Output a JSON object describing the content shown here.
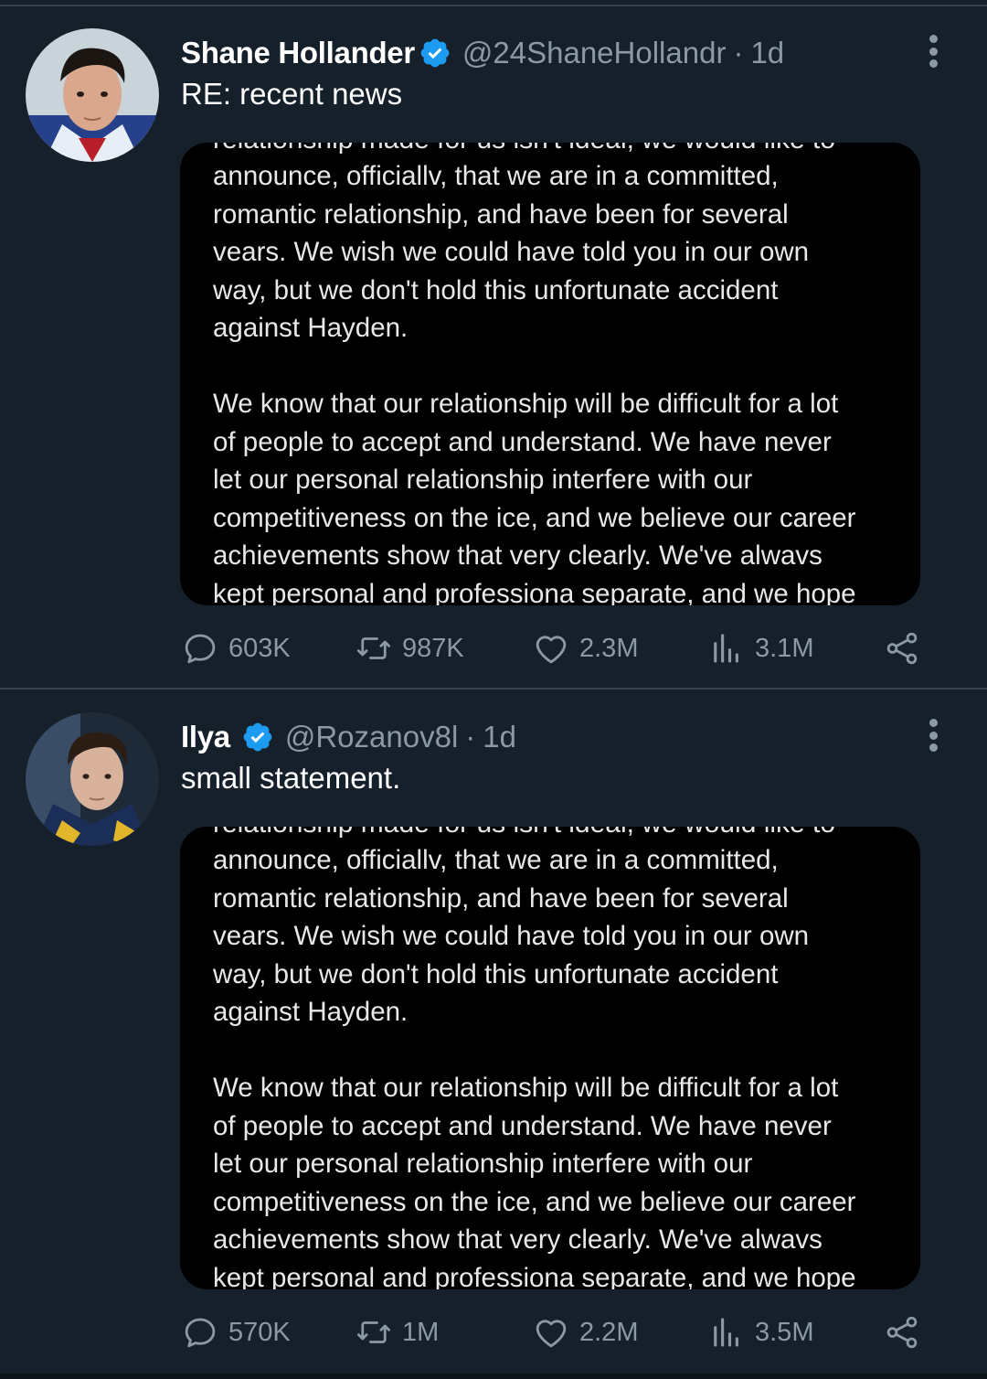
{
  "tweets": [
    {
      "name": "Shane Hollander",
      "handle": "@24ShaneHollandr",
      "separator": "·",
      "time": "1d",
      "text": "RE: recent news",
      "media": {
        "cut_line": "relationship made for us isn't ideal, we would like to",
        "paragraph1": [
          "announce, officiallv, that we are in a committed,",
          "romantic relationship, and have been for several",
          "vears. We wish we could have told you in our own",
          "way, but we don't hold this unfortunate accident",
          "against Hayden."
        ],
        "paragraph2": [
          "We know that our relationship will be difficult for a lot",
          "of people to accept and understand. We have never",
          "let our personal relationship interfere with our",
          "competitiveness on the ice, and we believe our career",
          "achievements show that very clearly. We've alwavs",
          "kept personal and professiona separate, and we hope"
        ]
      },
      "stats": {
        "replies": "603K",
        "retweets": "987K",
        "likes": "2.3M",
        "views": "3.1M"
      }
    },
    {
      "name": "Ilya",
      "handle": "@Rozanov8l",
      "separator": "·",
      "time": "1d",
      "text": "small statement.",
      "media": {
        "cut_line": "relationship made for us isn't ideal, we would like to",
        "paragraph1": [
          "announce, officiallv, that we are in a committed,",
          "romantic relationship, and have been for several",
          "vears. We wish we could have told you in our own",
          "way, but we don't hold this unfortunate accident",
          "against Hayden."
        ],
        "paragraph2": [
          "We know that our relationship will be difficult for a lot",
          "of people to accept and understand. We have never",
          "let our personal relationship interfere with our",
          "competitiveness on the ice, and we believe our career",
          "achievements show that very clearly. We've alwavs",
          "kept personal and professiona separate, and we hope"
        ]
      },
      "stats": {
        "replies": "570K",
        "retweets": "1M",
        "likes": "2.2M",
        "views": "3.5M"
      }
    }
  ],
  "icons": {
    "reply": "reply-icon",
    "retweet": "retweet-icon",
    "like": "heart-icon",
    "views": "views-icon",
    "share": "share-icon",
    "more": "more-vertical-icon",
    "verified": "verified-badge-icon"
  },
  "colors": {
    "background": "#15202b",
    "divider": "#38444d",
    "secondary_text": "#8b98a5",
    "verified": "#1d9bf0",
    "media_bg": "#000000"
  }
}
